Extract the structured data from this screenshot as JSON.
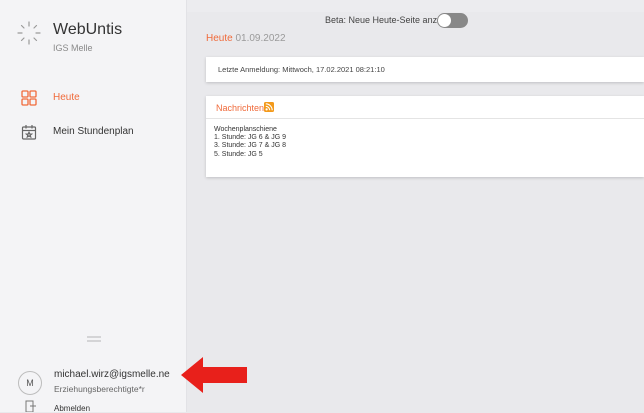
{
  "app": {
    "name": "WebUntis",
    "school": "IGS Melle"
  },
  "sidebar": {
    "items": [
      {
        "label": "Heute"
      },
      {
        "label": "Mein Stundenplan"
      }
    ]
  },
  "user": {
    "initial": "M",
    "email": "michael.wirz@igsmelle.ne",
    "role": "Erziehungsberechtigte*r",
    "logout_label": "Abmelden"
  },
  "header": {
    "beta_label": "Beta: Neue Heute-Seite anzeigen",
    "beta_enabled": false,
    "title": "Heute",
    "date": "01.09.2022"
  },
  "login_card": {
    "text": "Letzte Anmeldung: Mittwoch, 17.02.2021 08:21:10"
  },
  "news": {
    "title": "Nachrichten",
    "lines": [
      "Wochenplanschiene",
      "1. Stunde: JG 6 & JG 9",
      "3. Stunde: JG 7 & JG 8",
      "5. Stunde: JG 5"
    ]
  },
  "colors": {
    "accent": "#f06a3a",
    "rss": "#f39a1b",
    "annotation_arrow": "#e8201b",
    "sidebar_bg": "#f4f4f6",
    "content_bg": "#e9e9ec"
  }
}
